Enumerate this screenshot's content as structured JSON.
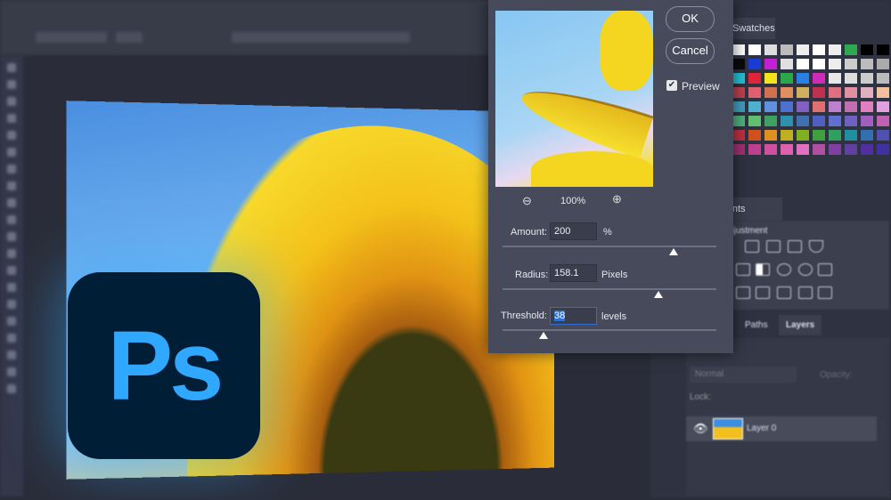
{
  "dialog": {
    "ok_label": "OK",
    "cancel_label": "Cancel",
    "preview_label": "Preview",
    "preview_checked": true,
    "zoom_level": "100%",
    "amount": {
      "label": "Amount:",
      "value": "200",
      "unit": "%",
      "slider_fraction": 0.8
    },
    "radius": {
      "label": "Radius:",
      "value": "158.1",
      "unit": "Pixels",
      "slider_fraction": 0.73
    },
    "threshold": {
      "label": "Threshold:",
      "value": "38",
      "unit": "levels",
      "slider_fraction": 0.19
    }
  },
  "logo": {
    "text": "Ps"
  },
  "panels": {
    "swatches_tab": "Swatches",
    "adjustments_tab": "Adjustments",
    "adjustments_heading": "Add an adjustment",
    "paths_tab": "Paths",
    "layers_tab": "Layers",
    "blend_mode": "Normal",
    "opacity_label": "Opacity:",
    "lock_label": "Lock:",
    "layer_name": "Layer 0"
  },
  "colors": {
    "accent": "#31a8ff",
    "logo_bg": "#001e36",
    "dialog_bg": "#464a5a"
  }
}
